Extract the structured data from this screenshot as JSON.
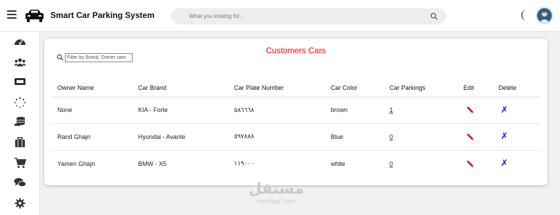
{
  "app": {
    "title": "Smart Car Parking System"
  },
  "search": {
    "placeholder": "What you looking for..."
  },
  "sidebar": {
    "items": [
      {
        "name": "dashboard-icon"
      },
      {
        "name": "customers-icon"
      },
      {
        "name": "tickets-icon"
      },
      {
        "name": "loading-icon"
      },
      {
        "name": "coins-icon"
      },
      {
        "name": "luggage-icon"
      },
      {
        "name": "cart-icon"
      },
      {
        "name": "chat-icon"
      },
      {
        "name": "settings-icon"
      }
    ]
  },
  "card": {
    "title": "Customers Cars",
    "filter_placeholder": "Filter by Brand, Owner nam"
  },
  "table": {
    "headers": [
      "Owner Name",
      "Car Brand",
      "Car Plate Number",
      "Car Color",
      "Car Parkings",
      "Edit",
      "Delete"
    ],
    "rows": [
      {
        "owner": "None",
        "brand": "KIA - Forte",
        "plate": "٥٨٦٦٦٨",
        "color": "brown",
        "parkings": "1"
      },
      {
        "owner": "Rand Ghajri",
        "brand": "Hyundai - Avante",
        "plate": "٥٩٧٨٨٨",
        "color": "Blue",
        "parkings": "0"
      },
      {
        "owner": "Yamen Ghajri",
        "brand": "BMW - X5",
        "plate": "١١٩٠٠٠",
        "color": "white",
        "parkings": "0"
      }
    ],
    "delete_glyph": "✗"
  },
  "watermark": {
    "arabic": "مستقل",
    "latin": "mostaql.com"
  },
  "colors": {
    "title_red": "#ff0000",
    "link_blue": "#1a0dab",
    "delete_blue": "#1515ff",
    "edit_red": "#e8102a"
  }
}
